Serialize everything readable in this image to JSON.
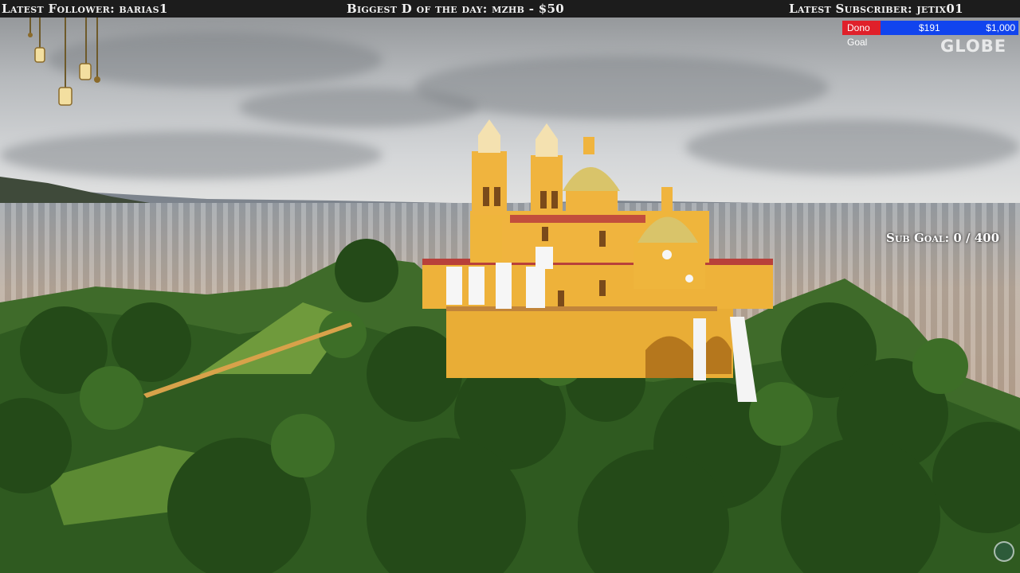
{
  "overlay": {
    "latest_follower": "Latest Follower: barias1",
    "biggest_donation": "Biggest D of the day: mzhb - $50",
    "latest_subscriber": "Latest Subscriber: jetix01",
    "dono_goal": {
      "label": "Dono Goal",
      "current": "$191",
      "target": "$1,000",
      "progress": 0.191,
      "label_color": "#e0202a",
      "bar_color": "#1144ee"
    },
    "watermark": "GLOBE",
    "sub_goal": "Sub Goal: 0 / 400"
  },
  "icons": [
    "hanging-lantern-icon",
    "channel-globe-logo-icon"
  ]
}
